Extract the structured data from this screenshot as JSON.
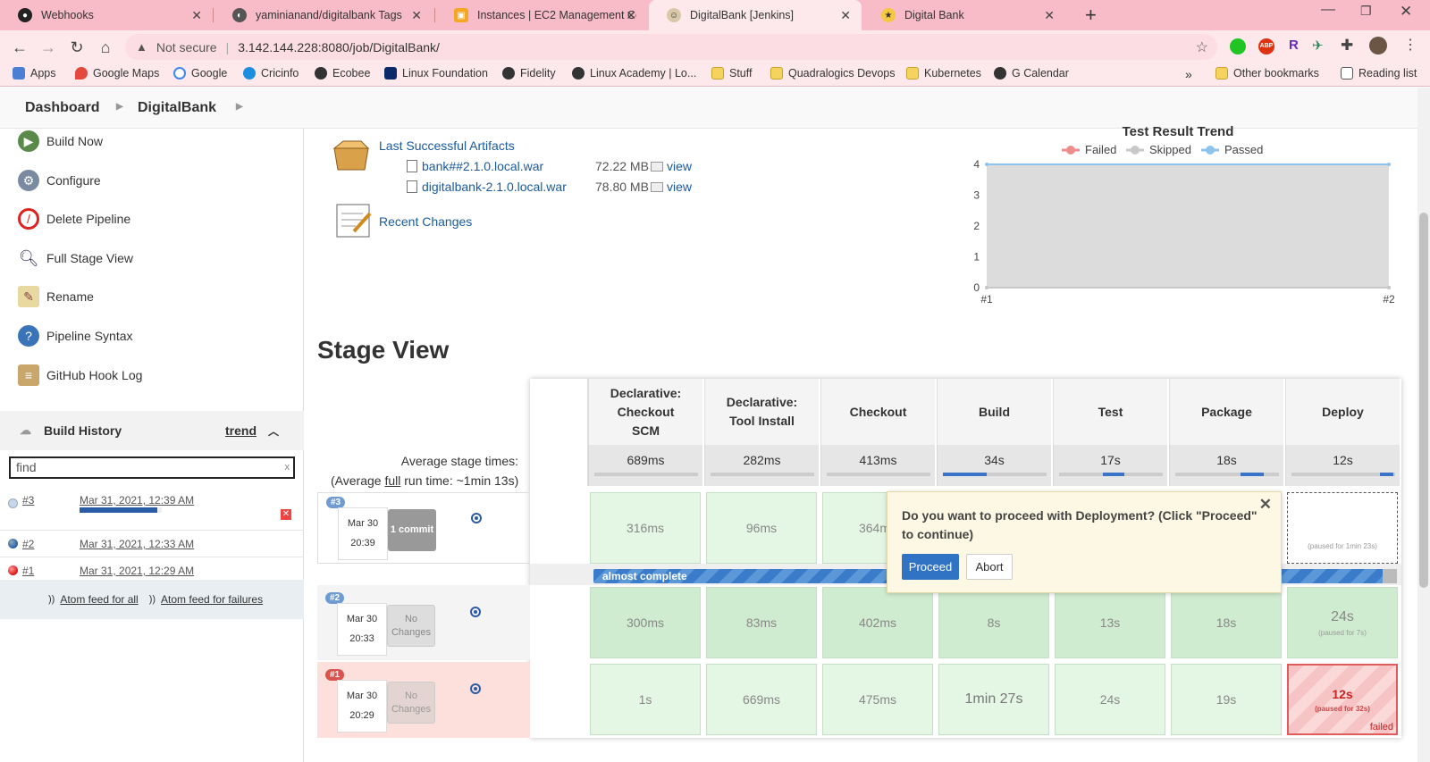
{
  "browser": {
    "tabs": [
      {
        "title": "Webhooks"
      },
      {
        "title": "yaminianand/digitalbank Tags"
      },
      {
        "title": "Instances | EC2 Management Co"
      },
      {
        "title": "DigitalBank [Jenkins]"
      },
      {
        "title": "Digital Bank"
      }
    ],
    "not_secure": "Not secure",
    "url": "3.142.144.228:8080/job/DigitalBank/",
    "bookmarks": [
      "Apps",
      "Google Maps",
      "Google",
      "Cricinfo",
      "Ecobee",
      "Linux Foundation",
      "Fidelity",
      "Linux Academy | Lo...",
      "Stuff",
      "Quadralogics Devops",
      "Kubernetes",
      "G Calendar"
    ],
    "other_bookmarks": "Other bookmarks",
    "reading_list": "Reading list",
    "overflow": "»"
  },
  "breadcrumb": {
    "items": [
      "Dashboard",
      "DigitalBank"
    ]
  },
  "sidebar": {
    "tasks": [
      "Build Now",
      "Configure",
      "Delete Pipeline",
      "Full Stage View",
      "Rename",
      "Pipeline Syntax",
      "GitHub Hook Log"
    ],
    "build_history": {
      "title": "Build History",
      "trend": "trend",
      "find_placeholder": "find",
      "builds": [
        {
          "number": "#3",
          "date": "Mar 31, 2021, 12:39 AM",
          "progress": 0.95
        },
        {
          "number": "#2",
          "date": "Mar 31, 2021, 12:33 AM"
        },
        {
          "number": "#1",
          "date": "Mar 31, 2021, 12:29 AM"
        }
      ],
      "feed_all": "Atom feed for all",
      "feed_failures": "Atom feed for failures"
    }
  },
  "artifacts": {
    "title": "Last Successful Artifacts",
    "files": [
      {
        "name": "bank##2.1.0.local.war",
        "size": "72.22 MB",
        "view": "view"
      },
      {
        "name": "digitalbank-2.1.0.local.war",
        "size": "78.80 MB",
        "view": "view"
      }
    ],
    "recent_changes": "Recent Changes"
  },
  "chart_data": {
    "type": "area",
    "title": "Test Result Trend",
    "legend": [
      "Failed",
      "Skipped",
      "Passed"
    ],
    "legend_position": "top",
    "x": [
      "#1",
      "#2"
    ],
    "series": [
      {
        "name": "Failed",
        "values": [
          0,
          0
        ],
        "color": "#ef8c8c"
      },
      {
        "name": "Skipped",
        "values": [
          0,
          0
        ],
        "color": "#c8c8c8"
      },
      {
        "name": "Passed",
        "values": [
          4,
          4
        ],
        "color": "#8cc4ef"
      }
    ],
    "ylim": [
      0,
      4
    ],
    "yticks": [
      "0",
      "1",
      "2",
      "3",
      "4"
    ]
  },
  "stage_view": {
    "title": "Stage View",
    "avg_label": "Average stage times:",
    "avg_full_prefix": "(Average ",
    "avg_full_link": "full",
    "avg_full_suffix": " run time: ~1min 13s)",
    "stages": [
      {
        "name": "Declarative: Checkout SCM",
        "avg": "689ms",
        "avg_fraction": 0.0
      },
      {
        "name": "Declarative: Tool Install",
        "avg": "282ms",
        "avg_fraction": 0.0
      },
      {
        "name": "Checkout",
        "avg": "413ms",
        "avg_fraction": 0.0
      },
      {
        "name": "Build",
        "avg": "34s",
        "avg_fraction": 0.42
      },
      {
        "name": "Test",
        "avg": "17s",
        "avg_fraction": 0.21
      },
      {
        "name": "Package",
        "avg": "18s",
        "avg_fraction": 0.22
      },
      {
        "name": "Deploy",
        "avg": "12s",
        "avg_fraction": 0.13
      }
    ],
    "runs": [
      {
        "badge": "#3",
        "date": "Mar 30",
        "time": "20:39",
        "changes": "1 commit",
        "cells": [
          "316ms",
          "96ms",
          "364ms",
          "",
          "",
          "",
          ""
        ],
        "paused_note": "(paused for 1min 23s)",
        "progress_label": "almost complete"
      },
      {
        "badge": "#2",
        "date": "Mar 30",
        "time": "20:33",
        "changes": "No Changes",
        "cells": [
          "300ms",
          "83ms",
          "402ms",
          "8s",
          "13s",
          "18s",
          "24s"
        ],
        "deploy_note": "(paused for 7s)"
      },
      {
        "badge": "#1",
        "date": "Mar 30",
        "time": "20:29",
        "changes": "No Changes",
        "cells": [
          "1s",
          "669ms",
          "475ms",
          "1min 27s",
          "24s",
          "19s",
          "12s"
        ],
        "deploy_note": "(paused for 32s)",
        "failed_label": "failed"
      }
    ],
    "input_prompt": {
      "message": "Do you want to proceed with Deployment? (Click \"Proceed\" to continue)",
      "proceed": "Proceed",
      "abort": "Abort"
    }
  }
}
